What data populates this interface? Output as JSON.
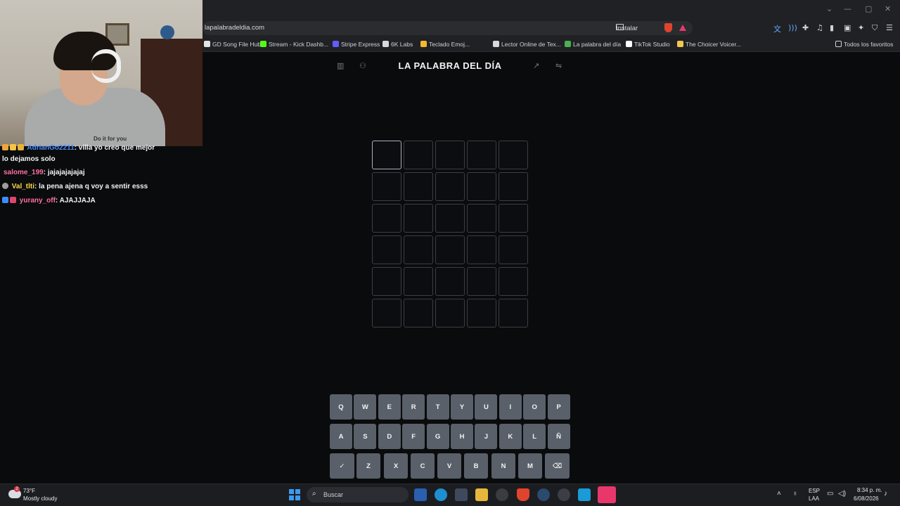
{
  "browser": {
    "url": "lapalabradeldia.com",
    "install_label": "Instalar",
    "bookmarks": [
      {
        "label": "GD Song File Hub",
        "color": "#e5e5e5"
      },
      {
        "label": "Stream - Kick Dashb...",
        "color": "#53fc18"
      },
      {
        "label": "Stripe Express",
        "color": "#635bff"
      },
      {
        "label": "6K Labs",
        "color": "#d9d9d9"
      },
      {
        "label": "Teclado Emoj...",
        "color": "#f5b82e"
      },
      {
        "label": "Lector Online de Tex...",
        "color": "#d9d9d9"
      },
      {
        "label": "La palabra del día",
        "color": "#4caf50"
      },
      {
        "label": "TikTok Studio",
        "color": "#ffffff"
      },
      {
        "label": "The Choicer Voicer...",
        "color": "#f2c94c"
      }
    ],
    "favorites_label": "Todos los favoritos"
  },
  "webcam": {
    "shirt_text": "Do it for you"
  },
  "chat": {
    "messages": [
      {
        "user": "AdrianGo2211",
        "text": ": villa yo creo que mejor",
        "user_color": "#4a8cff",
        "badge": "#f0a43a"
      },
      {
        "user": "",
        "text": "lo dejamos solo",
        "user_color": "#ffffff",
        "badge": ""
      },
      {
        "user": "salome_199",
        "text": ": jajajajajajaj",
        "user_color": "#ff6fa0",
        "badge": ""
      },
      {
        "user": "Val_tlti",
        "text": ": la pena ajena q voy a sentir esss",
        "user_color": "#ffd84a",
        "badge": "#9e9e9e"
      },
      {
        "user": "yurany_off",
        "text": ": AJAJJAJA",
        "user_color": "#ff6fa0",
        "badge": "#3a8eff"
      }
    ]
  },
  "game": {
    "title": "LA PALABRA DEL DÍA",
    "rows": 6,
    "cols": 5,
    "keyboard": [
      [
        "Q",
        "W",
        "E",
        "R",
        "T",
        "Y",
        "U",
        "I",
        "O",
        "P"
      ],
      [
        "A",
        "S",
        "D",
        "F",
        "G",
        "H",
        "J",
        "K",
        "L",
        "Ñ"
      ],
      [
        "✓",
        "Z",
        "X",
        "C",
        "V",
        "B",
        "N",
        "M",
        "⌫"
      ]
    ]
  },
  "taskbar": {
    "weather_temp": "73°F",
    "weather_condition": "Mostly cloudy",
    "weather_badge": "2",
    "search_placeholder": "Buscar",
    "lang_top": "ESP",
    "lang_bottom": "LAA",
    "time": "8:34 p. m.",
    "date": "6/08/2026"
  },
  "colors": {
    "key": "#5a6069",
    "cell_border": "#3b3e43",
    "active_cell_border": "#a9b2bf",
    "start": "#3b9af0"
  }
}
